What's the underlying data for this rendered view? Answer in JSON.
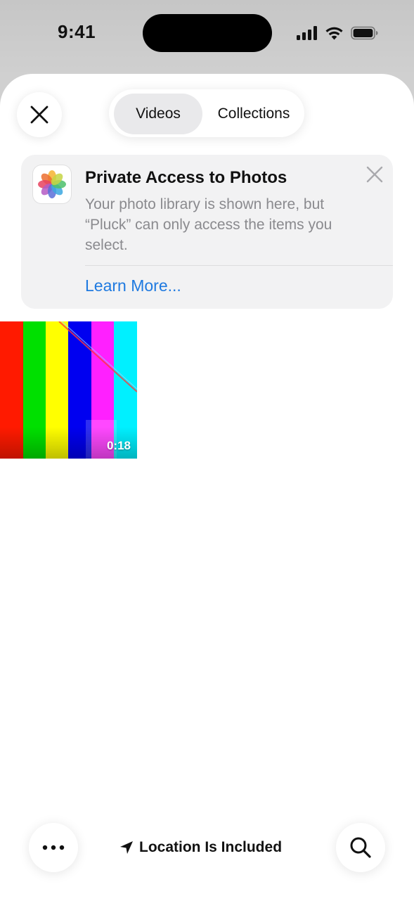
{
  "status_bar": {
    "time": "9:41",
    "icons": [
      "cellular-signal-icon",
      "wifi-icon",
      "battery-icon"
    ]
  },
  "picker": {
    "close_icon": "close-icon",
    "tabs": [
      {
        "label": "Videos",
        "selected": true
      },
      {
        "label": "Collections",
        "selected": false
      }
    ]
  },
  "banner": {
    "app_icon": "photos-app-icon",
    "title": "Private Access to Photos",
    "body": "Your photo library is shown here, but “Pluck” can only access the items you select.",
    "link_label": "Learn More...",
    "dismiss_icon": "close-icon"
  },
  "media": [
    {
      "type": "video",
      "duration": "0:18"
    }
  ],
  "toolbar": {
    "more_icon": "ellipsis-icon",
    "location_icon": "location-arrow-icon",
    "location_label": "Location Is Included",
    "search_icon": "search-icon"
  },
  "colors": {
    "link": "#1f7ae0",
    "secondary_text": "#8a8a8e",
    "segment_selected_bg": "#e9e9eb",
    "banner_bg": "#f2f2f3"
  }
}
